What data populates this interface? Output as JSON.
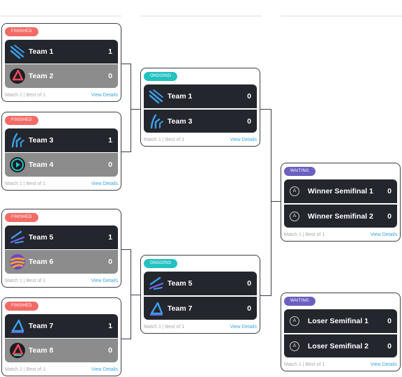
{
  "matches": [
    {
      "status": "FINISHED",
      "team1": {
        "name": "Team 1",
        "score": "1",
        "logo": "blue-swoosh-logo"
      },
      "team2": {
        "name": "Team 2",
        "score": "0",
        "logo": "red-triangle-logo"
      },
      "footer": "Match 1  |  Best of 1",
      "link": "View Details"
    },
    {
      "status": "FINISHED",
      "team1": {
        "name": "Team 3",
        "score": "1",
        "logo": "blue-claw-logo"
      },
      "team2": {
        "name": "Team 4",
        "score": "0",
        "logo": "teal-play-logo"
      },
      "footer": "Match 1  |  Best of 1",
      "link": "View Details"
    },
    {
      "status": "FINISHED",
      "team1": {
        "name": "Team 5",
        "score": "1",
        "logo": "purple-blue-swoosh-logo"
      },
      "team2": {
        "name": "Team 6",
        "score": "0",
        "logo": "orange-stripes-logo"
      },
      "footer": "Match 1  |  Best of 1",
      "link": "View Details"
    },
    {
      "status": "FINISHED",
      "team1": {
        "name": "Team 7",
        "score": "1",
        "logo": "blue-triangle-logo"
      },
      "team2": {
        "name": "Team 8",
        "score": "0",
        "logo": "red-teal-triangle-logo"
      },
      "footer": "Match 1  |  Best of 1",
      "link": "View Details"
    },
    {
      "status": "ONGOING",
      "team1": {
        "name": "Team 1",
        "score": "0",
        "logo": "blue-swoosh-logo"
      },
      "team2": {
        "name": "Team 3",
        "score": "0",
        "logo": "blue-claw-logo"
      },
      "footer": "Match 1  |  Best of 1",
      "link": "View Details"
    },
    {
      "status": "ONGOING",
      "team1": {
        "name": "Team 5",
        "score": "0",
        "logo": "purple-blue-swoosh-logo"
      },
      "team2": {
        "name": "Team 7",
        "score": "0",
        "logo": "blue-triangle-logo"
      },
      "footer": "Match 1  |  Best of 1",
      "link": "View Details"
    },
    {
      "status": "WAITING",
      "team1": {
        "name": "Winner Semifinal 1",
        "score": "0",
        "logo": "placeholder-a-icon"
      },
      "team2": {
        "name": "Winner Semifinal 2",
        "score": "0",
        "logo": "placeholder-a-icon"
      },
      "footer": "Match 1  |  Best of 1",
      "link": "View Details"
    },
    {
      "status": "WAITING",
      "team1": {
        "name": "Loser Semifinal 1",
        "score": "0",
        "logo": "placeholder-a-icon"
      },
      "team2": {
        "name": "Loser Semifinal 2",
        "score": "0",
        "logo": "placeholder-a-icon"
      },
      "footer": "Match 1  |  Best of 1",
      "link": "View Details"
    }
  ],
  "placeholder_letter": "A",
  "colors": {
    "finished": "#f26b66",
    "ongoing": "#23c2c0",
    "waiting": "#6b5fc0",
    "dark_row": "#23262d",
    "loser_row": "#8c8c8c",
    "link": "#3aa6e0"
  }
}
